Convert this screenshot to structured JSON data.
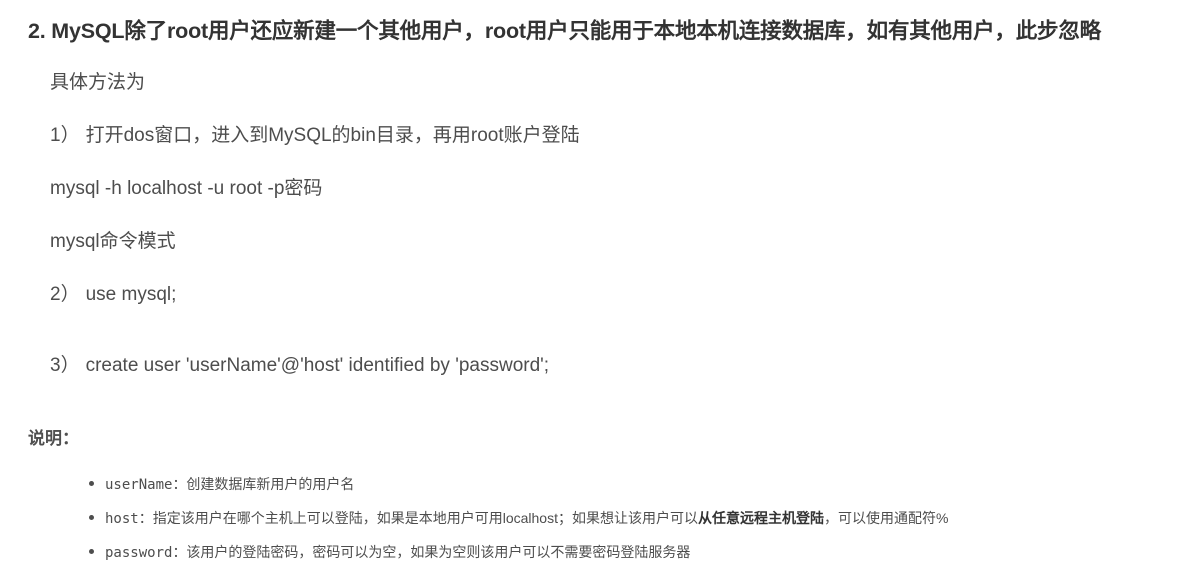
{
  "heading": "2. MySQL除了root用户还应新建一个其他用户，root用户只能用于本地本机连接数据库，如有其他用户，此步忽略",
  "method_intro": "具体方法为",
  "step1": {
    "num": "1）",
    "text": "打开dos窗口，进入到MySQL的bin目录，再用root账户登陆"
  },
  "command_login": "mysql -h localhost -u root -p密码",
  "mode_text": "mysql命令模式",
  "step2": {
    "num": "2）",
    "text": "use mysql;"
  },
  "step3": {
    "num": "3）",
    "text": "create user 'userName'@'host' identified by 'password';"
  },
  "note_label": "说明：",
  "notes": [
    {
      "term": "userName",
      "desc": "：创建数据库新用户的用户名"
    },
    {
      "term": "host",
      "desc": "：指定该用户在哪个主机上可以登陆，如果是本地用户可用localhost；如果想让该用户可以",
      "emph": "从任意远程主机登陆",
      "tail": "，可以使用通配符%"
    },
    {
      "term": "password",
      "desc": "：该用户的登陆密码，密码可以为空，如果为空则该用户可以不需要密码登陆服务器"
    }
  ]
}
